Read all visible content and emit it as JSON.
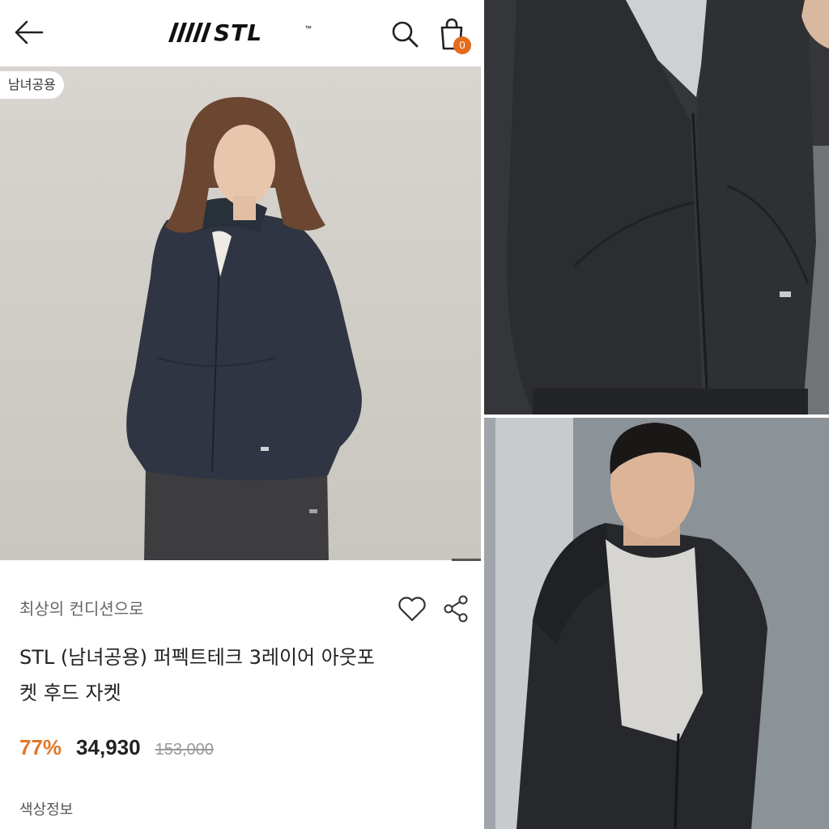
{
  "header": {
    "logo_text": "STL",
    "logo_mark": "™",
    "back_icon": "arrow-left-icon",
    "search_icon": "search-icon",
    "cart_icon": "shopping-bag-icon",
    "cart_count": "0"
  },
  "product": {
    "tag": "남녀공용",
    "subtitle": "최상의 컨디션으로",
    "title": "STL (남녀공용) 퍼펙트테크 3레이어 아웃포켓 후드 자켓",
    "discount": "77%",
    "price": "34,930",
    "original_price": "153,000",
    "color_info_label": "색상정보",
    "like_icon": "heart-icon",
    "share_icon": "share-icon"
  },
  "colors": {
    "accent": "#e0782a",
    "badge": "#e46a1c",
    "text_dark": "#222222",
    "text_muted": "#666666",
    "jacket": "#2f3542"
  }
}
